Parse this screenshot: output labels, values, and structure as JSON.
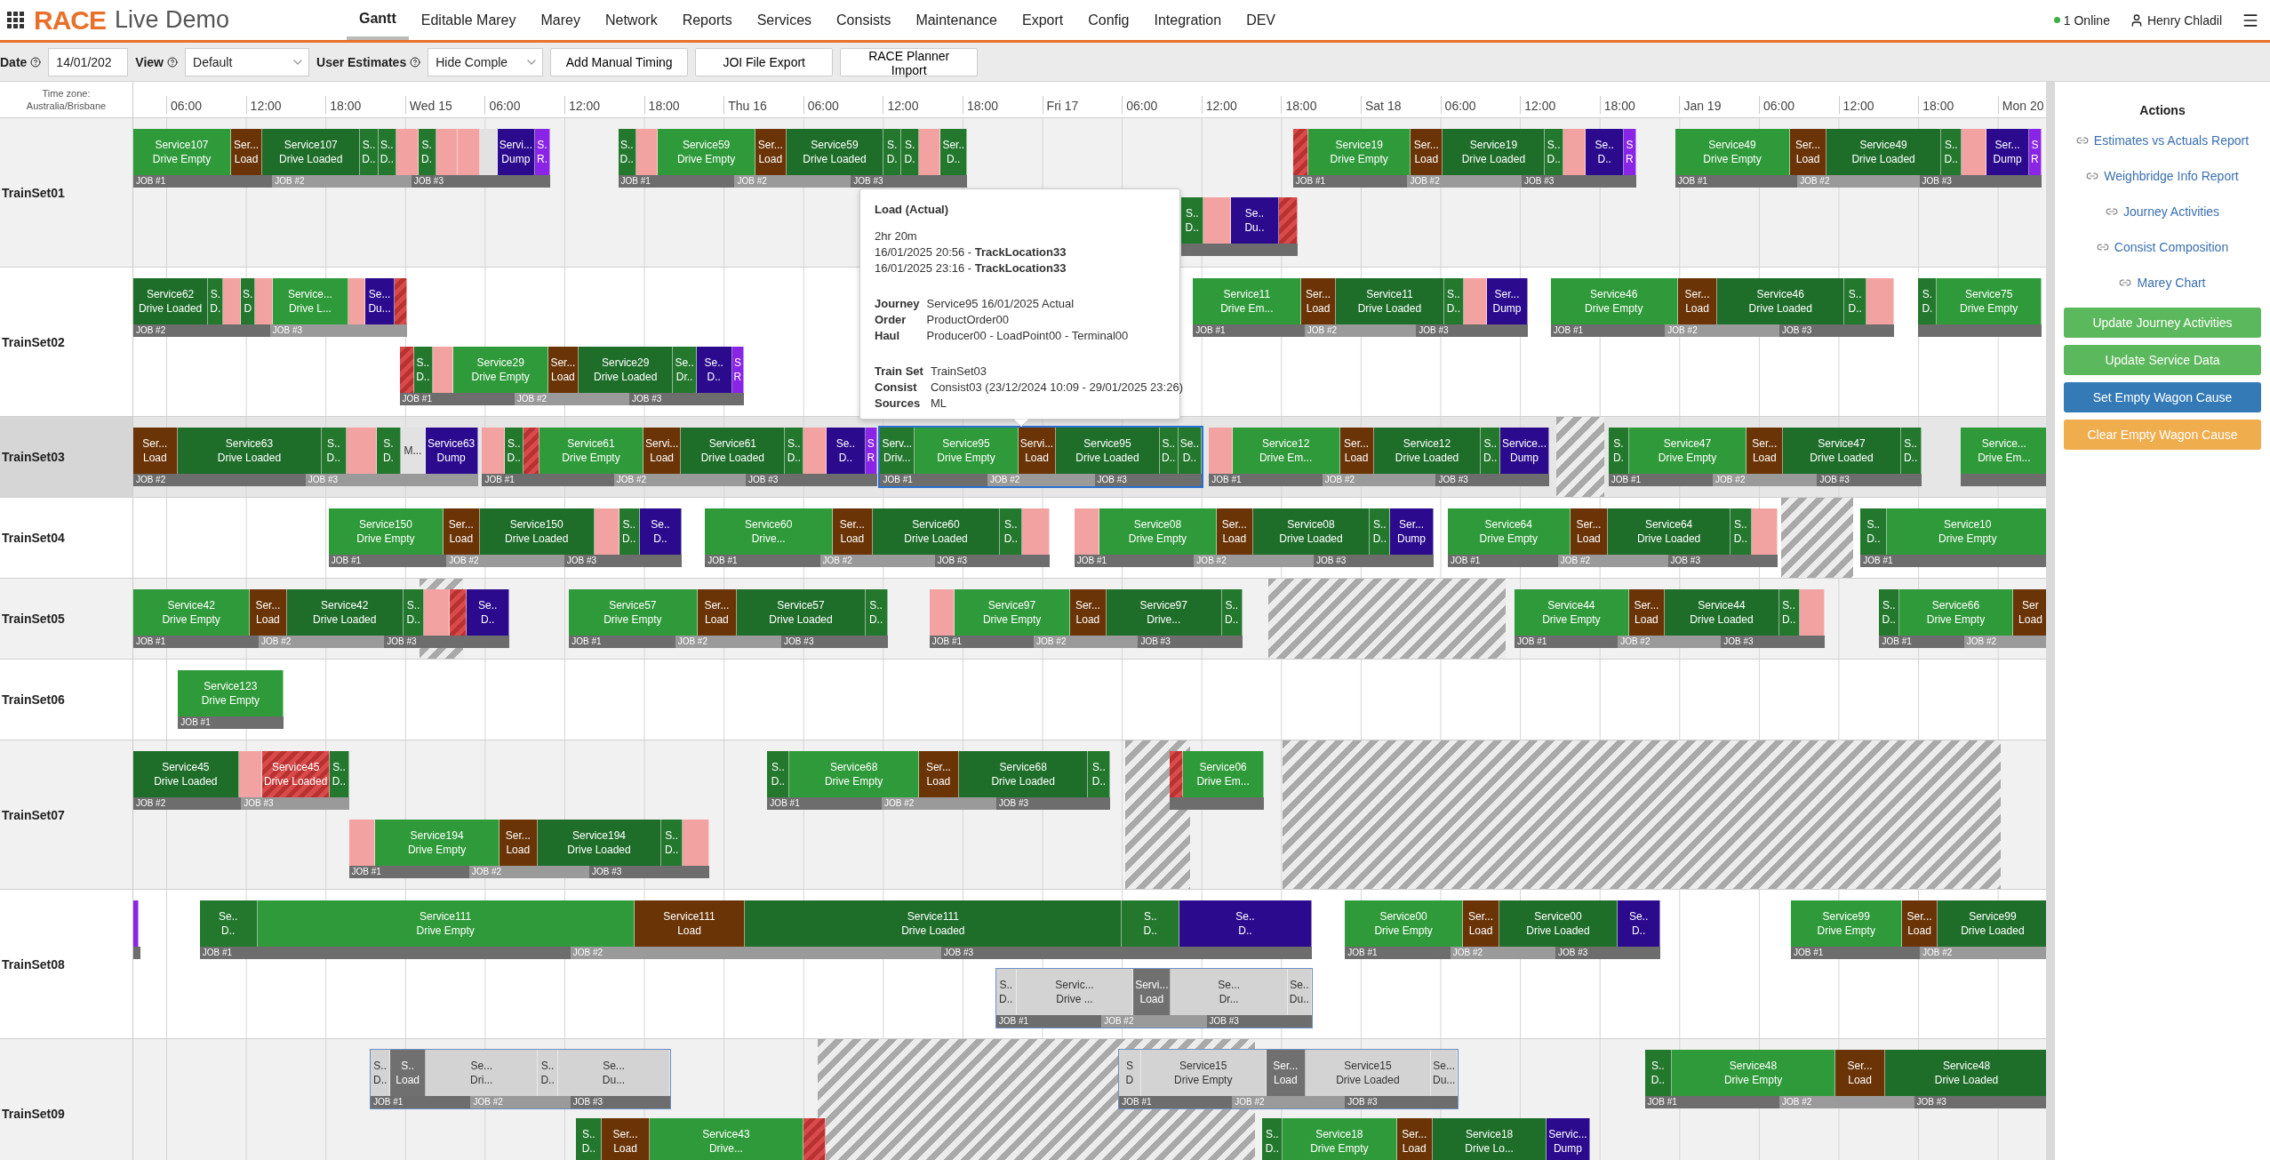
{
  "app": {
    "brand": "RACE",
    "subtitle": "Live Demo"
  },
  "nav": [
    {
      "label": "Gantt",
      "selected": true
    },
    {
      "label": "Editable Marey",
      "selected": false
    },
    {
      "label": "Marey",
      "selected": false
    },
    {
      "label": "Network",
      "selected": false
    },
    {
      "label": "Reports",
      "selected": false
    },
    {
      "label": "Services",
      "selected": false
    },
    {
      "label": "Consists",
      "selected": false
    },
    {
      "label": "Maintenance",
      "selected": false
    },
    {
      "label": "Export",
      "selected": false
    },
    {
      "label": "Config",
      "selected": false
    },
    {
      "label": "Integration",
      "selected": false
    },
    {
      "label": "DEV",
      "selected": false
    }
  ],
  "status": {
    "online": "1 Online",
    "user": "Henry Chladil"
  },
  "toolbar": {
    "date_label": "Date",
    "date_value": "14/01/202",
    "view_label": "View",
    "view_value": "Default",
    "estimates_label": "User Estimates",
    "estimates_value": "Hide Comple",
    "buttons": [
      "Add Manual Timing",
      "JOI File Export",
      "RACE Planner Import"
    ]
  },
  "timezone": [
    "Time zone:",
    "Australia/Brisbane"
  ],
  "ticks": [
    "06:00",
    "12:00",
    "18:00",
    "Wed 15",
    "06:00",
    "12:00",
    "18:00",
    "Thu 16",
    "06:00",
    "12:00",
    "18:00",
    "Fri 17",
    "06:00",
    "12:00",
    "18:00",
    "Sat 18",
    "06:00",
    "12:00",
    "18:00",
    "Jan 19",
    "06:00",
    "12:00",
    "18:00",
    "Mon 20"
  ],
  "rows": [
    {
      "name": "TrainSet01",
      "selected": false,
      "lanes": [
        [
          {
            "kind": "actual",
            "selected": false,
            "jobs": [
              "JOB #1",
              "JOB #2",
              "JOB #3"
            ],
            "segments": [
              {
                "kind": "empty",
                "service": "Service107",
                "activity": "Drive Empty"
              },
              {
                "kind": "load",
                "service": "Ser...",
                "activity": "Load"
              },
              {
                "kind": "loaded",
                "service": "Service107",
                "activity": "Drive Loaded"
              },
              {
                "kind": "stop",
                "service": "S..",
                "activity": "D.."
              },
              {
                "kind": "stop",
                "service": "S..",
                "activity": "D.."
              },
              {
                "kind": "delay"
              },
              {
                "kind": "stop",
                "service": "S.",
                "activity": "D."
              },
              {
                "kind": "delay"
              },
              {
                "kind": "delay"
              },
              {
                "kind": "idle"
              },
              {
                "kind": "dump",
                "service": "Servi...",
                "activity": "Dump"
              },
              {
                "kind": "return",
                "service": "S.",
                "activity": "R."
              }
            ]
          },
          {
            "kind": "actual",
            "selected": false,
            "jobs": [
              "JOB #1",
              "JOB #2",
              "JOB #3"
            ],
            "segments": [
              {
                "kind": "stop",
                "service": "S..",
                "activity": "D.."
              },
              {
                "kind": "delay"
              },
              {
                "kind": "empty",
                "service": "Service59",
                "activity": "Drive Empty"
              },
              {
                "kind": "load",
                "service": "Ser...",
                "activity": "Load"
              },
              {
                "kind": "loaded",
                "service": "Service59",
                "activity": "Drive Loaded"
              },
              {
                "kind": "stop",
                "service": "S.",
                "activity": "D."
              },
              {
                "kind": "stop",
                "service": "S.",
                "activity": "D."
              },
              {
                "kind": "delay"
              },
              {
                "kind": "stop",
                "service": "Ser..",
                "activity": "D.."
              }
            ]
          },
          {
            "kind": "actual",
            "selected": false,
            "jobs": [
              "JOB #1",
              "JOB #2",
              "JOB #3"
            ],
            "segments": [
              {
                "kind": "fault"
              },
              {
                "kind": "empty",
                "service": "Service19",
                "activity": "Drive Empty"
              },
              {
                "kind": "load",
                "service": "Ser...",
                "activity": "Load"
              },
              {
                "kind": "loaded",
                "service": "Service19",
                "activity": "Drive Loaded"
              },
              {
                "kind": "stop",
                "service": "S..",
                "activity": "D.."
              },
              {
                "kind": "delay"
              },
              {
                "kind": "dump",
                "service": "Se..",
                "activity": "D.."
              },
              {
                "kind": "return",
                "service": "S",
                "activity": "R"
              }
            ]
          },
          {
            "kind": "actual",
            "selected": false,
            "jobs": [
              "JOB #1",
              "JOB #2",
              "JOB #3"
            ],
            "segments": [
              {
                "kind": "empty",
                "service": "Service49",
                "activity": "Drive Empty"
              },
              {
                "kind": "load",
                "service": "Ser...",
                "activity": "Load"
              },
              {
                "kind": "loaded",
                "service": "Service49",
                "activity": "Drive Loaded"
              },
              {
                "kind": "stop",
                "service": "S..",
                "activity": "D.."
              },
              {
                "kind": "delay"
              },
              {
                "kind": "dump",
                "service": "Ser...",
                "activity": "Dump"
              },
              {
                "kind": "return",
                "service": "S",
                "activity": "R"
              }
            ]
          }
        ],
        [
          {
            "kind": "actual",
            "selected": false,
            "segments": [
              {
                "kind": "stop",
                "service": "S..",
                "activity": "D.."
              },
              {
                "kind": "delay"
              },
              {
                "kind": "dump",
                "service": "Se..",
                "activity": "Du.."
              },
              {
                "kind": "fault"
              }
            ]
          }
        ]
      ]
    },
    {
      "name": "TrainSet02",
      "selected": false,
      "lanes": [
        [
          {
            "kind": "actual",
            "selected": false,
            "jobs": [
              "JOB #2",
              "JOB #3"
            ],
            "segments": [
              {
                "kind": "loaded",
                "service": "Service62",
                "activity": "Drive Loaded"
              },
              {
                "kind": "stop",
                "service": "S.",
                "activity": "D."
              },
              {
                "kind": "delay"
              },
              {
                "kind": "stop",
                "service": "S.",
                "activity": "D"
              },
              {
                "kind": "delay"
              },
              {
                "kind": "empty",
                "service": "Service...",
                "activity": "Drive L..."
              },
              {
                "kind": "delay"
              },
              {
                "kind": "dump",
                "service": "Se...",
                "activity": "Du..."
              },
              {
                "kind": "fault"
              }
            ]
          },
          {
            "kind": "actual",
            "selected": false,
            "jobs": [
              "JOB #1",
              "JOB #2",
              "JOB #3"
            ],
            "segments": [
              {
                "kind": "empty",
                "service": "Service11",
                "activity": "Drive Em..."
              },
              {
                "kind": "load",
                "service": "Ser...",
                "activity": "Load"
              },
              {
                "kind": "loaded",
                "service": "Service11",
                "activity": "Drive Loaded"
              },
              {
                "kind": "stop",
                "service": "S..",
                "activity": "D.."
              },
              {
                "kind": "delay"
              },
              {
                "kind": "dump",
                "service": "Ser...",
                "activity": "Dump"
              }
            ]
          },
          {
            "kind": "actual",
            "selected": false,
            "jobs": [
              "JOB #1",
              "JOB #2",
              "JOB #3"
            ],
            "segments": [
              {
                "kind": "empty",
                "service": "Service46",
                "activity": "Drive Empty"
              },
              {
                "kind": "load",
                "service": "Ser...",
                "activity": "Load"
              },
              {
                "kind": "loaded",
                "service": "Service46",
                "activity": "Drive Loaded"
              },
              {
                "kind": "stop",
                "service": "S..",
                "activity": "D.."
              },
              {
                "kind": "delay"
              }
            ]
          },
          {
            "kind": "actual",
            "selected": false,
            "segments": [
              {
                "kind": "stop",
                "service": "S.",
                "activity": "D."
              },
              {
                "kind": "empty",
                "service": "Service75",
                "activity": "Drive Empty"
              }
            ]
          }
        ],
        [
          {
            "kind": "actual",
            "selected": false,
            "jobs": [
              "JOB #1",
              "JOB #2",
              "JOB #3"
            ],
            "segments": [
              {
                "kind": "fault"
              },
              {
                "kind": "stop",
                "service": "S..",
                "activity": "D.."
              },
              {
                "kind": "delay"
              },
              {
                "kind": "empty",
                "service": "Service29",
                "activity": "Drive Empty"
              },
              {
                "kind": "load",
                "service": "Ser...",
                "activity": "Load"
              },
              {
                "kind": "loaded",
                "service": "Service29",
                "activity": "Drive Loaded"
              },
              {
                "kind": "stop",
                "service": "Se..",
                "activity": "Dr.."
              },
              {
                "kind": "dump",
                "service": "Se..",
                "activity": "D.."
              },
              {
                "kind": "return",
                "service": "S",
                "activity": "R"
              }
            ]
          }
        ]
      ]
    },
    {
      "name": "TrainSet03",
      "selected": true,
      "lanes": [
        [
          {
            "kind": "actual",
            "selected": false,
            "jobs": [
              "JOB #2",
              "JOB #3"
            ],
            "segments": [
              {
                "kind": "load",
                "service": "Ser...",
                "activity": "Load"
              },
              {
                "kind": "loaded",
                "service": "Service63",
                "activity": "Drive Loaded"
              },
              {
                "kind": "stop",
                "service": "S..",
                "activity": "D.."
              },
              {
                "kind": "delay"
              },
              {
                "kind": "stop",
                "service": "S.",
                "activity": "D."
              },
              {
                "kind": "idle",
                "service": "M..."
              },
              {
                "kind": "dump",
                "service": "Service63",
                "activity": "Dump"
              }
            ]
          },
          {
            "kind": "actual",
            "selected": false,
            "jobs": [
              "JOB #1",
              "JOB #2",
              "JOB #3"
            ],
            "segments": [
              {
                "kind": "delay"
              },
              {
                "kind": "stop",
                "service": "S..",
                "activity": "D.."
              },
              {
                "kind": "fault"
              },
              {
                "kind": "empty",
                "service": "Service61",
                "activity": "Drive Empty"
              },
              {
                "kind": "load",
                "service": "Servi...",
                "activity": "Load"
              },
              {
                "kind": "loaded",
                "service": "Service61",
                "activity": "Drive Loaded"
              },
              {
                "kind": "stop",
                "service": "S..",
                "activity": "D.."
              },
              {
                "kind": "delay"
              },
              {
                "kind": "dump",
                "service": "Se..",
                "activity": "D.."
              },
              {
                "kind": "return",
                "service": "S",
                "activity": "R"
              }
            ]
          },
          {
            "kind": "actual",
            "selected": true,
            "jobs": [
              "JOB #1",
              "JOB #2",
              "JOB #3"
            ],
            "segments": [
              {
                "kind": "stop",
                "service": "Serv...",
                "activity": "Driv..."
              },
              {
                "kind": "empty",
                "service": "Service95",
                "activity": "Drive Empty"
              },
              {
                "kind": "load",
                "service": "Servi...",
                "activity": "Load"
              },
              {
                "kind": "loaded",
                "service": "Service95",
                "activity": "Drive Loaded"
              },
              {
                "kind": "stop",
                "service": "S..",
                "activity": "D.."
              },
              {
                "kind": "stop",
                "service": "Se..",
                "activity": "D.."
              }
            ]
          },
          {
            "kind": "actual",
            "selected": false,
            "jobs": [
              "JOB #1",
              "JOB #2",
              "JOB #3"
            ],
            "segments": [
              {
                "kind": "delay"
              },
              {
                "kind": "empty",
                "service": "Service12",
                "activity": "Drive Em..."
              },
              {
                "kind": "load",
                "service": "Ser...",
                "activity": "Load"
              },
              {
                "kind": "loaded",
                "service": "Service12",
                "activity": "Drive Loaded"
              },
              {
                "kind": "stop",
                "service": "S..",
                "activity": "D.."
              },
              {
                "kind": "dump",
                "service": "Service...",
                "activity": "Dump"
              }
            ]
          },
          {
            "kind": "actual",
            "selected": false,
            "jobs": [
              "JOB #1",
              "JOB #2",
              "JOB #3"
            ],
            "segments": [
              {
                "kind": "stop",
                "service": "S.",
                "activity": "D."
              },
              {
                "kind": "empty",
                "service": "Service47",
                "activity": "Drive Empty"
              },
              {
                "kind": "load",
                "service": "Ser...",
                "activity": "Load"
              },
              {
                "kind": "loaded",
                "service": "Service47",
                "activity": "Drive Loaded"
              },
              {
                "kind": "stop",
                "service": "S..",
                "activity": "D.."
              }
            ]
          },
          {
            "kind": "actual",
            "selected": false,
            "segments": [
              {
                "kind": "empty",
                "service": "Service...",
                "activity": "Drive Em..."
              }
            ]
          }
        ]
      ]
    },
    {
      "name": "TrainSet04",
      "selected": false,
      "lanes": [
        [
          {
            "kind": "actual",
            "selected": false,
            "jobs": [
              "JOB #1",
              "JOB #2",
              "JOB #3"
            ],
            "segments": [
              {
                "kind": "empty",
                "service": "Service150",
                "activity": "Drive Empty"
              },
              {
                "kind": "load",
                "service": "Ser...",
                "activity": "Load"
              },
              {
                "kind": "loaded",
                "service": "Service150",
                "activity": "Drive Loaded"
              },
              {
                "kind": "delay"
              },
              {
                "kind": "stop",
                "service": "S..",
                "activity": "D.."
              },
              {
                "kind": "dump",
                "service": "Se..",
                "activity": "D.."
              }
            ]
          },
          {
            "kind": "actual",
            "selected": false,
            "jobs": [
              "JOB #1",
              "JOB #2",
              "JOB #3"
            ],
            "segments": [
              {
                "kind": "empty",
                "service": "Service60",
                "activity": "Drive..."
              },
              {
                "kind": "load",
                "service": "Ser...",
                "activity": "Load"
              },
              {
                "kind": "loaded",
                "service": "Service60",
                "activity": "Drive Loaded"
              },
              {
                "kind": "stop",
                "service": "S..",
                "activity": "D.."
              },
              {
                "kind": "delay"
              }
            ]
          },
          {
            "kind": "actual",
            "selected": false,
            "jobs": [
              "JOB #1",
              "JOB #2",
              "JOB #3"
            ],
            "segments": [
              {
                "kind": "delay"
              },
              {
                "kind": "empty",
                "service": "Service08",
                "activity": "Drive Empty"
              },
              {
                "kind": "load",
                "service": "Ser...",
                "activity": "Load"
              },
              {
                "kind": "loaded",
                "service": "Service08",
                "activity": "Drive Loaded"
              },
              {
                "kind": "stop",
                "service": "S..",
                "activity": "D.."
              },
              {
                "kind": "dump",
                "service": "Ser...",
                "activity": "Dump"
              }
            ]
          },
          {
            "kind": "actual",
            "selected": false,
            "jobs": [
              "JOB #1",
              "JOB #2",
              "JOB #3"
            ],
            "segments": [
              {
                "kind": "empty",
                "service": "Service64",
                "activity": "Drive Empty"
              },
              {
                "kind": "load",
                "service": "Ser...",
                "activity": "Load"
              },
              {
                "kind": "loaded",
                "service": "Service64",
                "activity": "Drive Loaded"
              },
              {
                "kind": "stop",
                "service": "S..",
                "activity": "D.."
              },
              {
                "kind": "delay"
              }
            ]
          },
          {
            "kind": "actual",
            "selected": false,
            "jobs": [
              "JOB #1"
            ],
            "segments": [
              {
                "kind": "stop",
                "service": "S..",
                "activity": "D.."
              },
              {
                "kind": "empty",
                "service": "Service10",
                "activity": "Drive Empty"
              }
            ]
          }
        ]
      ]
    },
    {
      "name": "TrainSet05",
      "selected": false,
      "lanes": [
        [
          {
            "kind": "actual",
            "selected": false,
            "jobs": [
              "JOB #1",
              "JOB #2",
              "JOB #3"
            ],
            "segments": [
              {
                "kind": "empty",
                "service": "Service42",
                "activity": "Drive Empty"
              },
              {
                "kind": "load",
                "service": "Ser...",
                "activity": "Load"
              },
              {
                "kind": "loaded",
                "service": "Service42",
                "activity": "Drive Loaded"
              },
              {
                "kind": "stop",
                "service": "S..",
                "activity": "D.."
              },
              {
                "kind": "delay"
              },
              {
                "kind": "fault"
              },
              {
                "kind": "dump",
                "service": "Se..",
                "activity": "D.."
              }
            ]
          },
          {
            "kind": "actual",
            "selected": false,
            "jobs": [
              "JOB #1",
              "JOB #2",
              "JOB #3"
            ],
            "segments": [
              {
                "kind": "empty",
                "service": "Service57",
                "activity": "Drive Empty"
              },
              {
                "kind": "load",
                "service": "Ser...",
                "activity": "Load"
              },
              {
                "kind": "loaded",
                "service": "Service57",
                "activity": "Drive Loaded"
              },
              {
                "kind": "stop",
                "service": "S..",
                "activity": "D.."
              }
            ]
          },
          {
            "kind": "actual",
            "selected": false,
            "jobs": [
              "JOB #1",
              "JOB #2",
              "JOB #3"
            ],
            "segments": [
              {
                "kind": "delay"
              },
              {
                "kind": "empty",
                "service": "Service97",
                "activity": "Drive Empty"
              },
              {
                "kind": "load",
                "service": "Ser...",
                "activity": "Load"
              },
              {
                "kind": "loaded",
                "service": "Service97",
                "activity": "Drive..."
              },
              {
                "kind": "stop",
                "service": "S..",
                "activity": "D.."
              }
            ]
          },
          {
            "kind": "actual",
            "selected": false,
            "jobs": [
              "JOB #1",
              "JOB #2",
              "JOB #3"
            ],
            "segments": [
              {
                "kind": "empty",
                "service": "Service44",
                "activity": "Drive Empty"
              },
              {
                "kind": "load",
                "service": "Ser...",
                "activity": "Load"
              },
              {
                "kind": "loaded",
                "service": "Service44",
                "activity": "Drive Loaded"
              },
              {
                "kind": "stop",
                "service": "S..",
                "activity": "D.."
              },
              {
                "kind": "delay"
              }
            ]
          },
          {
            "kind": "actual",
            "selected": false,
            "jobs": [
              "JOB #1",
              "JOB #2"
            ],
            "segments": [
              {
                "kind": "stop",
                "service": "S..",
                "activity": "D.."
              },
              {
                "kind": "empty",
                "service": "Service66",
                "activity": "Drive Empty"
              },
              {
                "kind": "load",
                "service": "Ser",
                "activity": "Load"
              }
            ]
          }
        ]
      ]
    },
    {
      "name": "TrainSet06",
      "selected": false,
      "lanes": [
        [
          {
            "kind": "actual",
            "selected": false,
            "jobs": [
              "JOB #1"
            ],
            "segments": [
              {
                "kind": "empty",
                "service": "Service123",
                "activity": "Drive Empty"
              }
            ]
          }
        ]
      ]
    },
    {
      "name": "TrainSet07",
      "selected": false,
      "lanes": [
        [
          {
            "kind": "actual",
            "selected": false,
            "jobs": [
              "JOB #2",
              "JOB #3"
            ],
            "segments": [
              {
                "kind": "loaded",
                "service": "Service45",
                "activity": "Drive Loaded"
              },
              {
                "kind": "delay"
              },
              {
                "kind": "fault",
                "service": "Service45",
                "activity": "Drive Loaded"
              },
              {
                "kind": "stop",
                "service": "S..",
                "activity": "D.."
              }
            ]
          },
          {
            "kind": "actual",
            "selected": false,
            "jobs": [
              "JOB #1",
              "JOB #2",
              "JOB #3"
            ],
            "segments": [
              {
                "kind": "stop",
                "service": "S..",
                "activity": "D.."
              },
              {
                "kind": "empty",
                "service": "Service68",
                "activity": "Drive Empty"
              },
              {
                "kind": "load",
                "service": "Ser...",
                "activity": "Load"
              },
              {
                "kind": "loaded",
                "service": "Service68",
                "activity": "Drive Loaded"
              },
              {
                "kind": "stop",
                "service": "S..",
                "activity": "D.."
              }
            ]
          },
          {
            "kind": "actual",
            "selected": false,
            "segments": [
              {
                "kind": "fault"
              },
              {
                "kind": "empty",
                "service": "Service06",
                "activity": "Drive Em..."
              }
            ]
          }
        ],
        [
          {
            "kind": "actual",
            "selected": false,
            "jobs": [
              "JOB #1",
              "JOB #2",
              "JOB #3"
            ],
            "segments": [
              {
                "kind": "delay"
              },
              {
                "kind": "empty",
                "service": "Service194",
                "activity": "Drive Empty"
              },
              {
                "kind": "load",
                "service": "Ser...",
                "activity": "Load"
              },
              {
                "kind": "loaded",
                "service": "Service194",
                "activity": "Drive Loaded"
              },
              {
                "kind": "stop",
                "service": "S..",
                "activity": "D.."
              },
              {
                "kind": "delay"
              }
            ]
          }
        ]
      ]
    },
    {
      "name": "TrainSet08",
      "selected": false,
      "lanes": [
        [
          {
            "kind": "actual",
            "selected": false,
            "segments": [
              {
                "kind": "return"
              }
            ]
          },
          {
            "kind": "actual",
            "selected": false,
            "jobs": [
              "JOB #1",
              "JOB #2",
              "JOB #3"
            ],
            "segments": [
              {
                "kind": "stop",
                "service": "Se..",
                "activity": "D.."
              },
              {
                "kind": "empty",
                "service": "Service111",
                "activity": "Drive Empty"
              },
              {
                "kind": "load",
                "service": "Service111",
                "activity": "Load"
              },
              {
                "kind": "loaded",
                "service": "Service111",
                "activity": "Drive Loaded"
              },
              {
                "kind": "stop",
                "service": "S..",
                "activity": "D.."
              },
              {
                "kind": "dump",
                "service": "Se..",
                "activity": "D.."
              }
            ]
          },
          {
            "kind": "actual",
            "selected": false,
            "jobs": [
              "JOB #1",
              "JOB #2",
              "JOB #3"
            ],
            "segments": [
              {
                "kind": "empty",
                "service": "Service00",
                "activity": "Drive Empty"
              },
              {
                "kind": "load",
                "service": "Ser...",
                "activity": "Load"
              },
              {
                "kind": "loaded",
                "service": "Service00",
                "activity": "Drive Loaded"
              },
              {
                "kind": "dump",
                "service": "Se..",
                "activity": "D.."
              }
            ]
          },
          {
            "kind": "actual",
            "selected": false,
            "jobs": [
              "JOB #1",
              "JOB #2"
            ],
            "segments": [
              {
                "kind": "empty",
                "service": "Service99",
                "activity": "Drive Empty"
              },
              {
                "kind": "load",
                "service": "Ser...",
                "activity": "Load"
              },
              {
                "kind": "loaded",
                "service": "Service99",
                "activity": "Drive Loaded"
              }
            ]
          }
        ],
        [
          {
            "kind": "planned",
            "selected": false,
            "jobs": [
              "JOB #1",
              "JOB #2",
              "JOB #3"
            ],
            "segments": [
              {
                "kind": "stop",
                "service": "S..",
                "activity": "D.."
              },
              {
                "kind": "empty",
                "service": "Servic...",
                "activity": "Drive ..."
              },
              {
                "kind": "load",
                "service": "Servi...",
                "activity": "Load"
              },
              {
                "kind": "loaded",
                "service": "Se...",
                "activity": "Dr..."
              },
              {
                "kind": "stop",
                "service": "Se..",
                "activity": "Du.."
              }
            ]
          }
        ]
      ]
    },
    {
      "name": "TrainSet09",
      "selected": false,
      "lanes": [
        [
          {
            "kind": "planned",
            "selected": false,
            "jobs": [
              "JOB #1",
              "JOB #2",
              "JOB #3"
            ],
            "segments": [
              {
                "kind": "stop",
                "service": "S..",
                "activity": "D.."
              },
              {
                "kind": "load",
                "service": "S..",
                "activity": "Load"
              },
              {
                "kind": "empty",
                "service": "Se...",
                "activity": "Dri..."
              },
              {
                "kind": "stop",
                "service": "S..",
                "activity": "D.."
              },
              {
                "kind": "loaded",
                "service": "Se...",
                "activity": "Du..."
              }
            ]
          },
          {
            "kind": "planned",
            "selected": false,
            "jobs": [
              "JOB #1",
              "JOB #2",
              "JOB #3"
            ],
            "segments": [
              {
                "kind": "stop",
                "service": "S",
                "activity": "D"
              },
              {
                "kind": "empty",
                "service": "Service15",
                "activity": "Drive Empty"
              },
              {
                "kind": "load",
                "service": "Ser...",
                "activity": "Load"
              },
              {
                "kind": "loaded",
                "service": "Service15",
                "activity": "Drive Loaded"
              },
              {
                "kind": "stop",
                "service": "Se...",
                "activity": "Du..."
              }
            ]
          },
          {
            "kind": "actual",
            "selected": false,
            "jobs": [
              "JOB #1",
              "JOB #2",
              "JOB #3"
            ],
            "segments": [
              {
                "kind": "stop",
                "service": "S..",
                "activity": "D.."
              },
              {
                "kind": "empty",
                "service": "Service48",
                "activity": "Drive Empty"
              },
              {
                "kind": "load",
                "service": "Ser...",
                "activity": "Load"
              },
              {
                "kind": "loaded",
                "service": "Service48",
                "activity": "Drive Loaded"
              }
            ]
          }
        ],
        [
          {
            "kind": "actual",
            "selected": false,
            "segments": [
              {
                "kind": "stop",
                "service": "S..",
                "activity": "D.."
              },
              {
                "kind": "load",
                "service": "Ser...",
                "activity": "Load"
              },
              {
                "kind": "empty",
                "service": "Service43",
                "activity": "Drive..."
              },
              {
                "kind": "fault"
              }
            ]
          },
          {
            "kind": "actual",
            "selected": false,
            "segments": [
              {
                "kind": "stop",
                "service": "S..",
                "activity": "D.."
              },
              {
                "kind": "empty",
                "service": "Service18",
                "activity": "Drive Empty"
              },
              {
                "kind": "load",
                "service": "Ser...",
                "activity": "Load"
              },
              {
                "kind": "loaded",
                "service": "Service18",
                "activity": "Drive Lo..."
              },
              {
                "kind": "dump",
                "service": "Servic...",
                "activity": "Dump"
              }
            ]
          }
        ]
      ]
    }
  ],
  "tooltip": {
    "title": "Load (Actual)",
    "duration": "2hr 20m",
    "times": [
      "16/01/2025 20:56 - **TrackLocation33**",
      "16/01/2025 23:16 - **TrackLocation33**"
    ],
    "journey": [
      {
        "label": "Journey",
        "value": "Service95 16/01/2025 Actual"
      },
      {
        "label": "Order",
        "value": "ProductOrder00"
      },
      {
        "label": "Haul",
        "value": "Producer00 - LoadPoint00 - Terminal00"
      }
    ],
    "train": [
      {
        "label": "Train Set",
        "value": "TrainSet03"
      },
      {
        "label": "Consist",
        "value": "Consist03 (23/12/2024 10:09 - 29/01/2025 23:26)"
      },
      {
        "label": "Sources",
        "value": "ML"
      }
    ]
  },
  "actions": {
    "title": "Actions",
    "links": [
      "Estimates vs Actuals Report",
      "Weighbridge Info Report",
      "Journey Activities",
      "Consist Composition",
      "Marey Chart"
    ],
    "buttons": [
      {
        "label": "Update Journey Activities",
        "kind": "success"
      },
      {
        "label": "Update Service Data",
        "kind": "success"
      },
      {
        "label": "Set Empty Wagon Cause",
        "kind": "primary"
      },
      {
        "label": "Clear Empty Wagon Cause",
        "kind": "warning"
      }
    ]
  }
}
